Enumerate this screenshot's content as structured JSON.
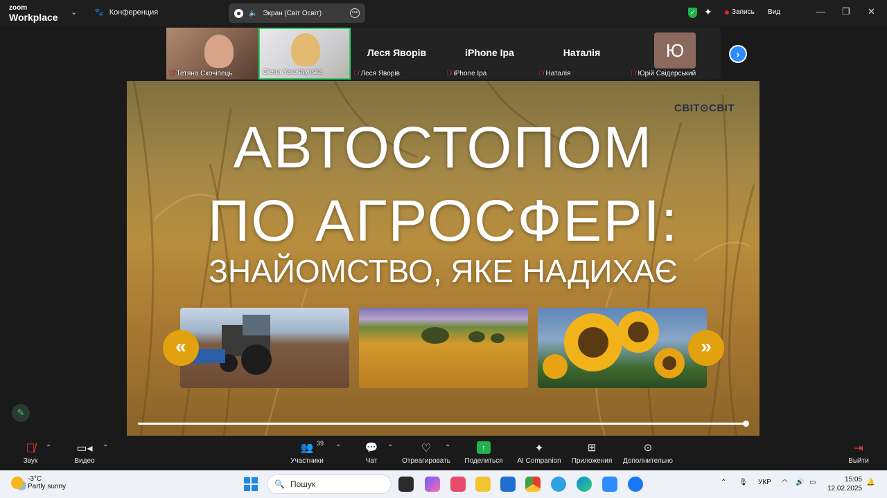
{
  "app": {
    "brand_small": "zoom",
    "brand_name": "Workplace",
    "meeting_label": "Конференция"
  },
  "screen_share": {
    "label": "Экран (Світ Освіт)"
  },
  "top_right": {
    "record_label": "Запись",
    "view_label": "Вид"
  },
  "participants": [
    {
      "name": "Тетяна Скочіпець",
      "muted": true,
      "video": true
    },
    {
      "name": "Olena Yaroshynska",
      "muted": false,
      "video": true,
      "active": true
    },
    {
      "name": "Леся Яворів",
      "display": "Леся Яворів",
      "muted": true
    },
    {
      "name": "iPhone Ipa",
      "display": "iPhone Ipa",
      "muted": true
    },
    {
      "name": "Наталія",
      "display": "Наталія",
      "muted": true
    },
    {
      "name": "Юрій Свідерський",
      "initial": "Ю",
      "muted": true
    }
  ],
  "slide": {
    "logo": "СВІТ⊙СВІТ",
    "title_line1": "АВТОСТОПОМ",
    "title_line2": "ПО АГРОСФЕРІ:",
    "subtitle": "ЗНАЙОМСТВО, ЯКЕ НАДИХАЄ",
    "prev_arrow": "«",
    "next_arrow": "»",
    "progress": 1.0
  },
  "toolbar": {
    "audio": "Звук",
    "video": "Видео",
    "participants": "Участники",
    "participants_count": "39",
    "chat": "Чат",
    "react": "Отреагировать",
    "share": "Поделиться",
    "ai": "AI Companion",
    "apps": "Приложения",
    "more": "Дополнительно",
    "leave": "Выйти"
  },
  "taskbar": {
    "weather_temp": "-3°C",
    "weather_desc": "Partly sunny",
    "search_placeholder": "Пошук",
    "lang": "УКР",
    "time": "15:05",
    "date": "12.02.2025"
  },
  "colors": {
    "accent_green": "#31d06c",
    "share_green": "#22b24c",
    "slide_arrow": "#e2a10f",
    "zoom_blue": "#2d8cff"
  }
}
